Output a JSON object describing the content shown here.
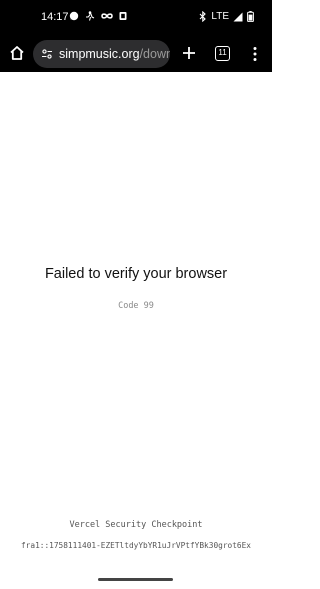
{
  "status_bar": {
    "time": "14:17",
    "network": "LTE",
    "notification_icons": [
      "chat-bubble-icon",
      "running-person-icon",
      "infinity-icon",
      "square-app-icon"
    ],
    "system_icons": [
      "bluetooth-icon",
      "cell-signal-icon",
      "battery-icon"
    ]
  },
  "browser": {
    "url_domain": "simpmusic.org",
    "url_path": "/downl",
    "tab_count": "11"
  },
  "page": {
    "title": "Failed to verify your browser",
    "code": "Code 99",
    "footer_title": "Vercel Security Checkpoint",
    "footer_id": "fra1::1758111401-EZETltdyYbYR1uJrVPtfYBk30grot6Ex"
  }
}
